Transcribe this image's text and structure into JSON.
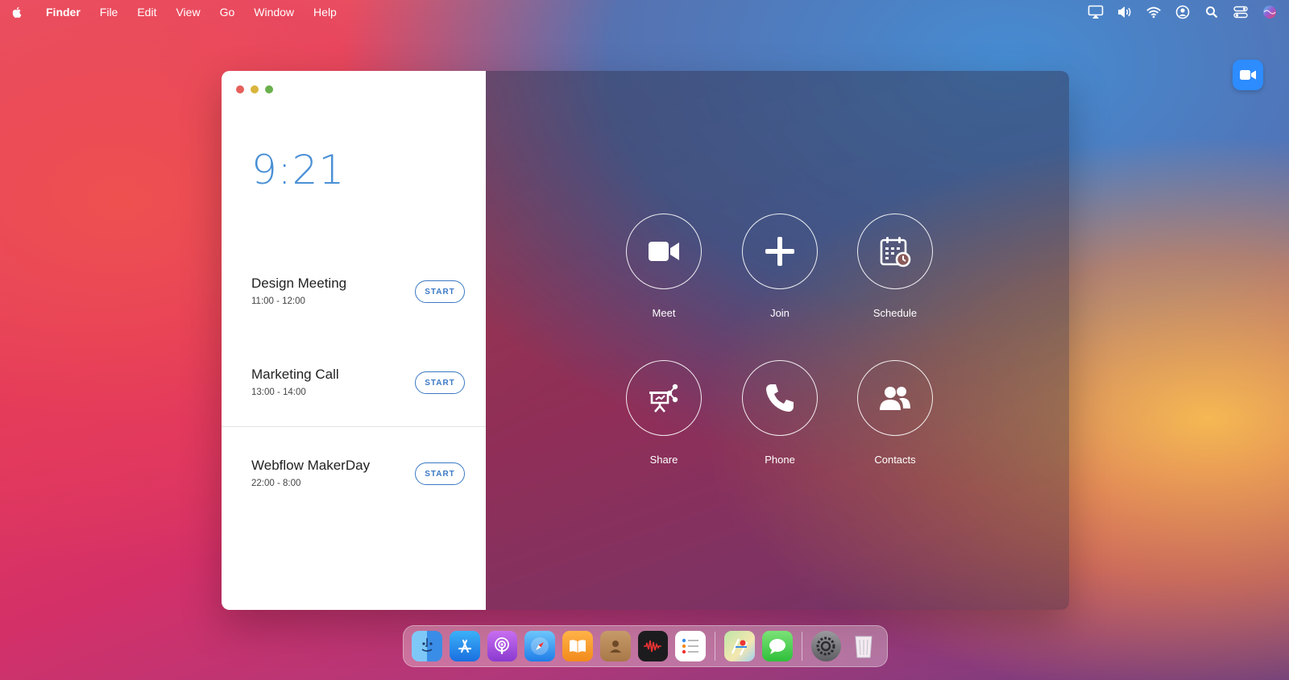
{
  "menubar": {
    "apple_icon": "apple-icon",
    "app_name": "Finder",
    "items": [
      "File",
      "Edit",
      "View",
      "Go",
      "Window",
      "Help"
    ],
    "status_icons": [
      "airplay-icon",
      "volume-icon",
      "wifi-icon",
      "user-account-icon",
      "search-icon",
      "control-center-icon",
      "siri-icon"
    ]
  },
  "desktop": {
    "zoom_icon": "zoom-video-icon"
  },
  "window": {
    "clock": "9:21",
    "meetings": [
      {
        "title": "Design Meeting",
        "time": "11:00 - 12:00",
        "button": "START"
      },
      {
        "title": "Marketing Call",
        "time": "13:00 - 14:00",
        "button": "START"
      },
      {
        "title": "Webflow MakerDay",
        "time": "22:00 - 8:00",
        "button": "START"
      }
    ],
    "actions": [
      {
        "label": "Meet",
        "icon": "video-camera-icon"
      },
      {
        "label": "Join",
        "icon": "plus-icon"
      },
      {
        "label": "Schedule",
        "icon": "calendar-clock-icon"
      },
      {
        "label": "Share",
        "icon": "share-screen-icon"
      },
      {
        "label": "Phone",
        "icon": "phone-icon"
      },
      {
        "label": "Contacts",
        "icon": "contacts-icon"
      }
    ]
  },
  "dock": {
    "apps": [
      "finder-icon",
      "app-store-icon",
      "podcasts-icon",
      "safari-icon",
      "books-icon",
      "contacts-app-icon",
      "voice-memos-icon",
      "reminders-icon",
      "maps-icon",
      "messages-icon",
      "system-preferences-icon",
      "trash-icon"
    ]
  }
}
